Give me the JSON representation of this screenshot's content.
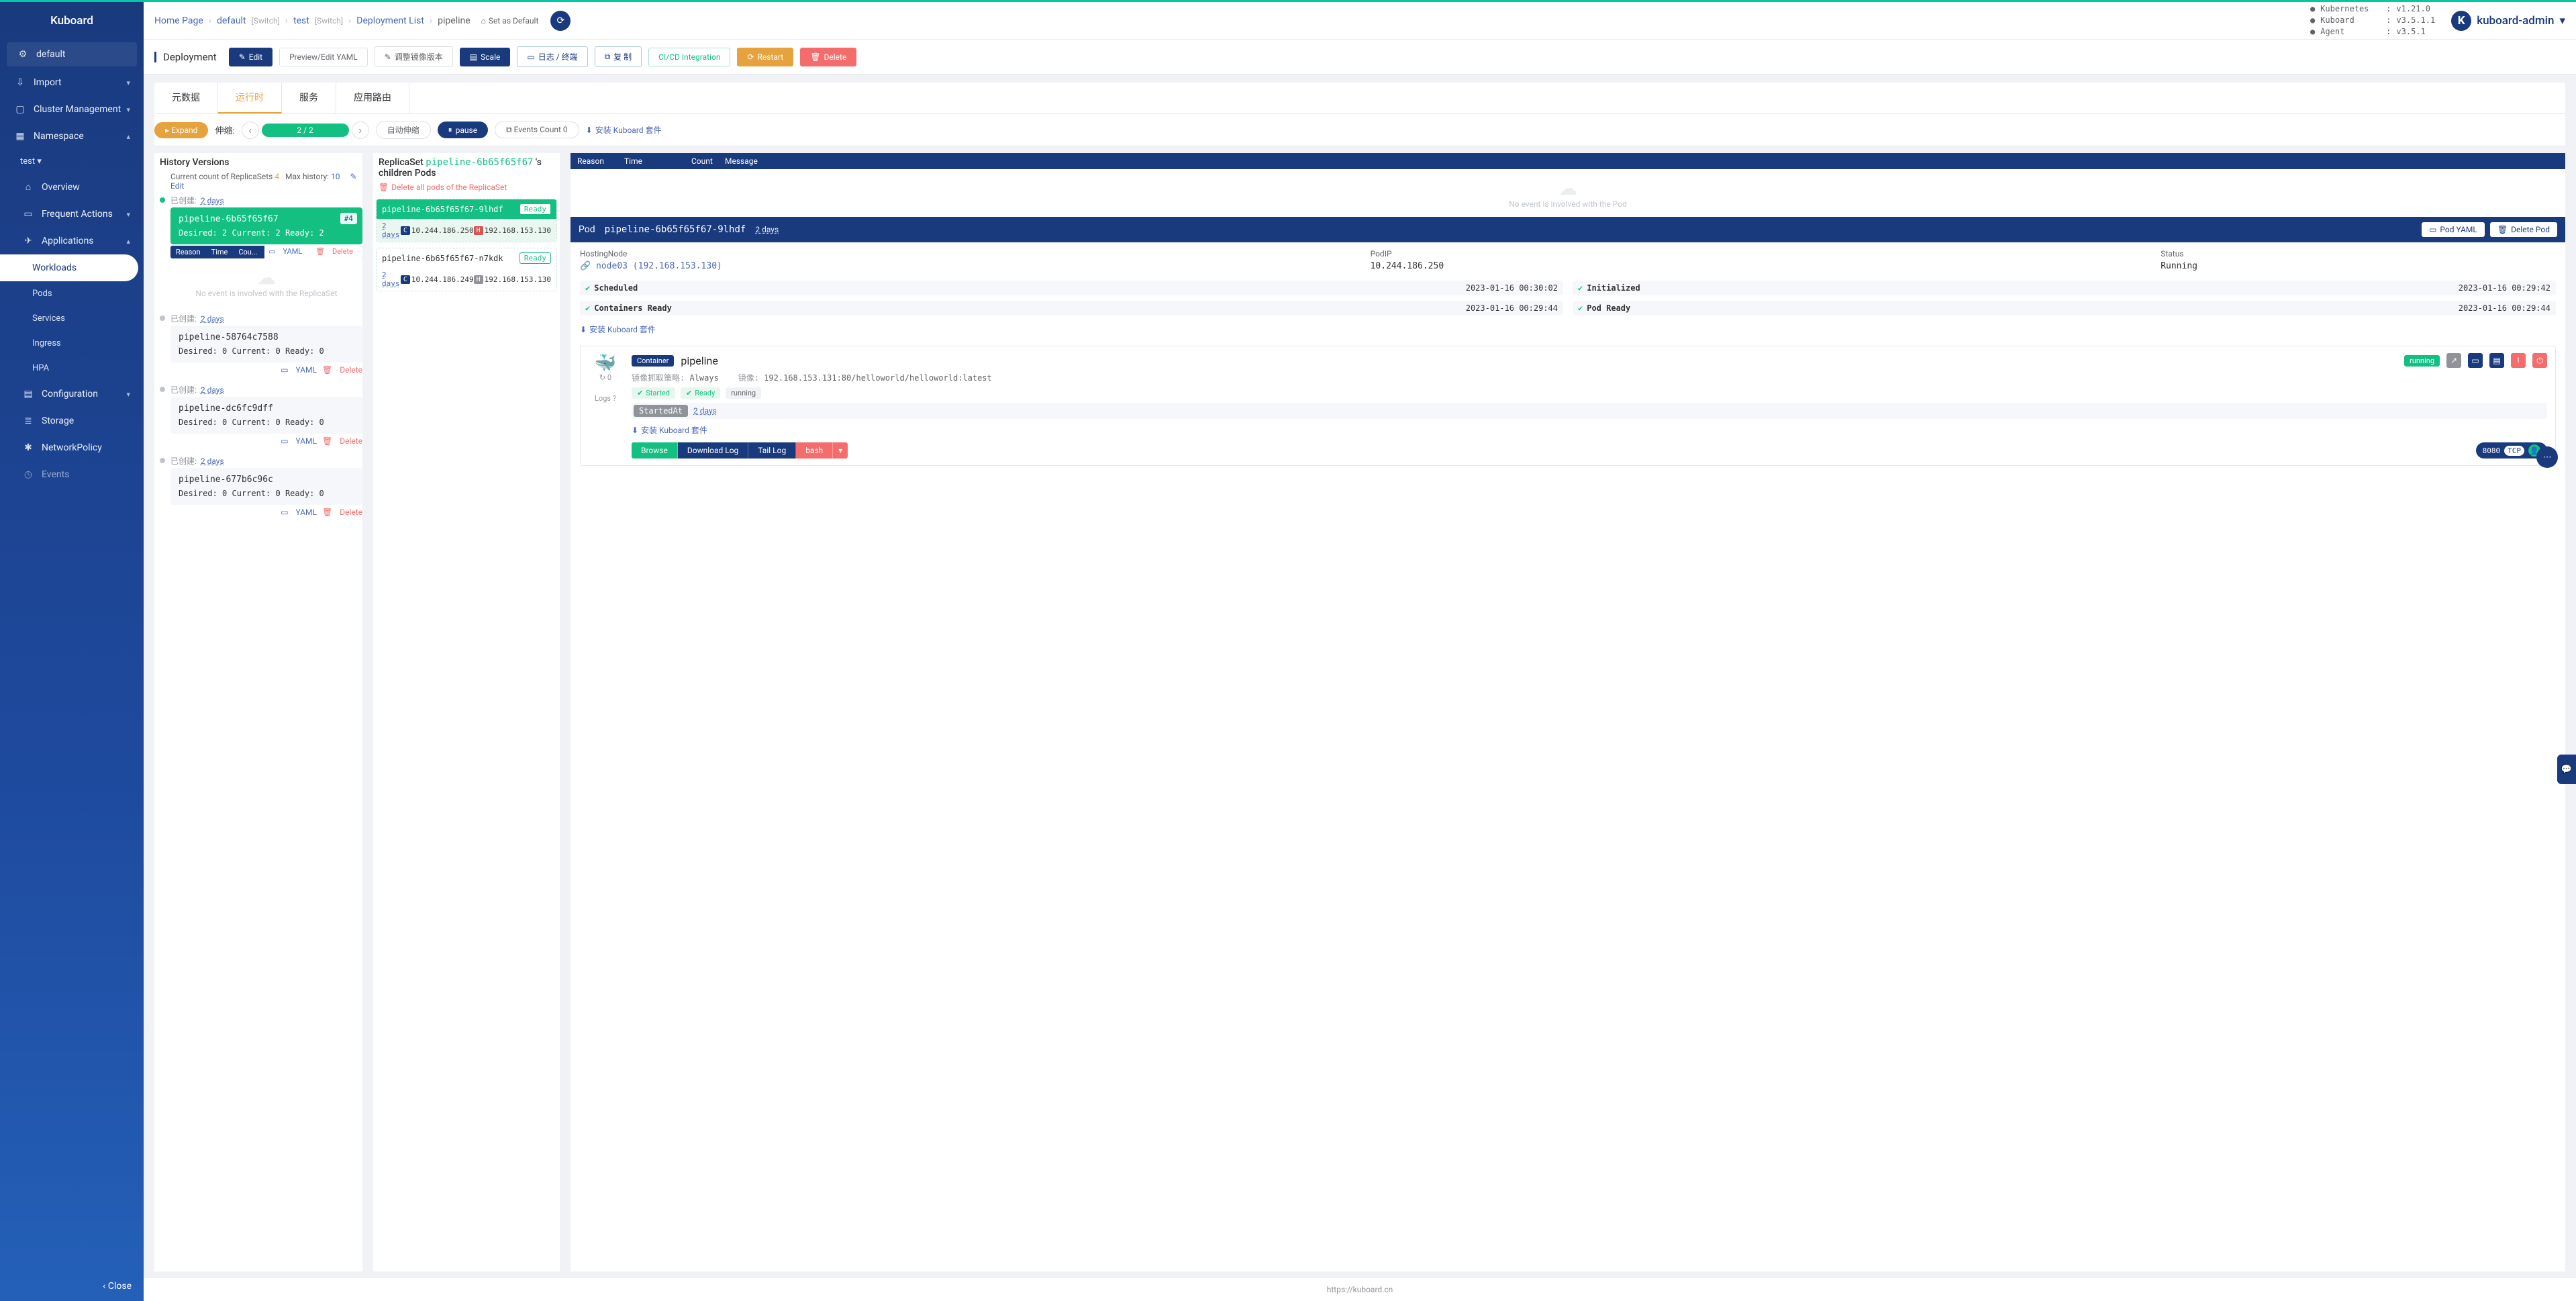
{
  "brand": "Kuboard",
  "sidebar": {
    "default": "default",
    "import": "Import",
    "cluster": "Cluster Management",
    "namespace": "Namespace",
    "test": "test",
    "overview": "Overview",
    "frequent": "Frequent Actions",
    "applications": "Applications",
    "workloads": "Workloads",
    "pods": "Pods",
    "services": "Services",
    "ingress": "Ingress",
    "hpa": "HPA",
    "configuration": "Configuration",
    "storage": "Storage",
    "networkpolicy": "NetworkPolicy",
    "events": "Events",
    "close": "Close"
  },
  "breadcrumb": {
    "home": "Home Page",
    "default": "default",
    "switch": "[Switch]",
    "test": "test",
    "deploy_list": "Deployment List",
    "current": "pipeline",
    "set_default": "Set as Default"
  },
  "versions": {
    "k8s_lbl": "Kubernetes",
    "k8s_val": "v1.21.0",
    "kb_lbl": "Kuboard",
    "kb_val": "v3.5.1.1",
    "ag_lbl": "Agent",
    "ag_val": "v3.5.1"
  },
  "user": "kuboard-admin",
  "toolbar": {
    "title": "Deployment",
    "edit": "Edit",
    "yaml": "Preview/Edit YAML",
    "mirror": "调整镜像版本",
    "scale": "Scale",
    "log": "日志 / 终端",
    "copy": "复 制",
    "cicd": "CI/CD Integration",
    "restart": "Restart",
    "delete": "Delete"
  },
  "tabs": {
    "meta": "元数据",
    "runtime": "运行时",
    "service": "服务",
    "route": "应用路由"
  },
  "scale": {
    "expand": "Expand",
    "label": "伸缩:",
    "value": "2 / 2",
    "auto": "自动伸缩",
    "pause": "pause",
    "events": "Events Count 0",
    "install": "安装 Kuboard 套件"
  },
  "history": {
    "title": "History Versions",
    "count_prefix": "Current count of ReplicaSets ",
    "count_val": "4",
    "max_prefix": "Max history: ",
    "max_val": "10",
    "edit": "Edit",
    "yaml": "YAML",
    "delete": "Delete",
    "no_event": "No event is involved with the ReplicaSet",
    "tbl_reason": "Reason",
    "tbl_time": "Time",
    "tbl_cou": "Cou...",
    "items": [
      {
        "created": "已创建:",
        "age": "2 days",
        "name": "pipeline-6b65f65f67",
        "rev": "#4",
        "stats": "Desired: 2 Current: 2 Ready: 2",
        "active": true
      },
      {
        "created": "已创建:",
        "age": "2 days",
        "name": "pipeline-58764c7588",
        "stats": "Desired: 0 Current: 0 Ready: 0",
        "active": false
      },
      {
        "created": "已创建:",
        "age": "2 days",
        "name": "pipeline-dc6fc9dff",
        "stats": "Desired: 0 Current: 0 Ready: 0",
        "active": false
      },
      {
        "created": "已创建:",
        "age": "2 days",
        "name": "pipeline-677b6c96c",
        "stats": "Desired: 0 Current: 0 Ready: 0",
        "active": false
      }
    ]
  },
  "replicaset": {
    "prefix": "ReplicaSet ",
    "name": "pipeline-6b65f65f67",
    "suffix": " 's children Pods",
    "delete_all": "Delete all pods of the ReplicaSet",
    "pods": [
      {
        "name": "pipeline-6b65f65f67-9lhdf",
        "ready": "Ready",
        "age": "2 days",
        "cip": "10.244.186.250",
        "hip": "192.168.153.130",
        "active": true
      },
      {
        "name": "pipeline-6b65f65f67-n7kdk",
        "ready": "Ready",
        "age": "2 days",
        "cip": "10.244.186.249",
        "hip": "192.168.153.130",
        "active": false
      }
    ]
  },
  "events": {
    "reason": "Reason",
    "time": "Time",
    "count": "Count",
    "message": "Message",
    "none": "No event is involved with the Pod"
  },
  "pod": {
    "label": "Pod",
    "name": "pipeline-6b65f65f67-9lhdf",
    "age": "2 days",
    "yaml": "Pod YAML",
    "delete": "Delete Pod",
    "hosting_lbl": "HostingNode",
    "hosting_val": "node03 (192.168.153.130)",
    "podip_lbl": "PodIP",
    "podip_val": "10.244.186.250",
    "status_lbl": "Status",
    "status_val": "Running",
    "conds": [
      {
        "k": "Scheduled",
        "t": "2023-01-16 00:30:02"
      },
      {
        "k": "Initialized",
        "t": "2023-01-16 00:29:42"
      },
      {
        "k": "Containers Ready",
        "t": "2023-01-16 00:29:44"
      },
      {
        "k": "Pod Ready",
        "t": "2023-01-16 00:29:44"
      }
    ],
    "install": "安装 Kuboard 套件"
  },
  "container": {
    "restart_lbl": "↻ 0",
    "logs_lbl": "Logs",
    "tag": "Container",
    "name": "pipeline",
    "running": "running",
    "pull_lbl": "镜像抓取策略:",
    "pull_val": "Always",
    "image_lbl": "镜像:",
    "image_val": "192.168.153.131:80/helloworld/helloworld:latest",
    "started": "Started",
    "ready": "Ready",
    "state": "running",
    "started_at_k": "StartedAt",
    "started_at_v": "2 days",
    "install": "安装 Kuboard 套件",
    "browse": "Browse",
    "download": "Download Log",
    "tail": "Tail Log",
    "bash": "bash",
    "port": "8080",
    "proto": "TCP"
  },
  "footer": "https://kuboard.cn"
}
